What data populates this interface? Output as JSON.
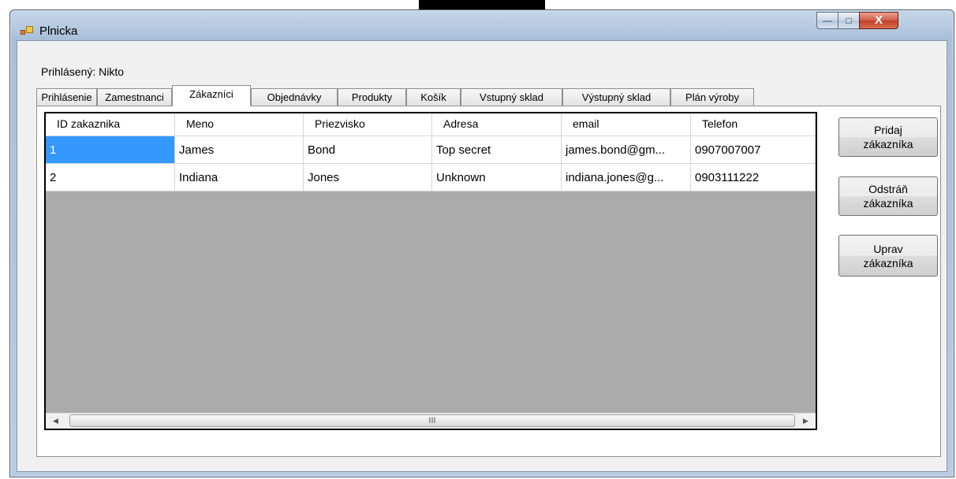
{
  "window": {
    "title": "Plnicka",
    "minimize_glyph": "—",
    "maximize_glyph": "□",
    "close_glyph": "X"
  },
  "status": {
    "logged_in": "Prihlásený: Nikto"
  },
  "tabs": [
    {
      "label": "Prihlásenie"
    },
    {
      "label": "Zamestnanci"
    },
    {
      "label": "Zákazníci"
    },
    {
      "label": "Objednávky"
    },
    {
      "label": "Produkty"
    },
    {
      "label": "Košík"
    },
    {
      "label": "Vstupný sklad"
    },
    {
      "label": "Výstupný sklad"
    },
    {
      "label": "Plán výroby"
    }
  ],
  "active_tab": "Zákazníci",
  "grid": {
    "columns": [
      "ID zakaznika",
      "Meno",
      "Priezvisko",
      "Adresa",
      "email",
      "Telefon"
    ],
    "rows": [
      [
        "1",
        "James",
        "Bond",
        "Top secret",
        "james.bond@gm...",
        "0907007007"
      ],
      [
        "2",
        "Indiana",
        "Jones",
        "Unknown",
        "indiana.jones@g...",
        "0903111222"
      ]
    ],
    "selected_cell": "1",
    "scroll_thumb_label": "III"
  },
  "buttons": {
    "add": [
      "Pridaj",
      "zákazníka"
    ],
    "remove": [
      "Odstráň",
      "zákazníka"
    ],
    "edit": [
      "Uprav",
      "zákazníka"
    ]
  },
  "colors": {
    "selection": "#3399ff",
    "grid_empty": "#ababab",
    "close_button": "#c2402b"
  }
}
